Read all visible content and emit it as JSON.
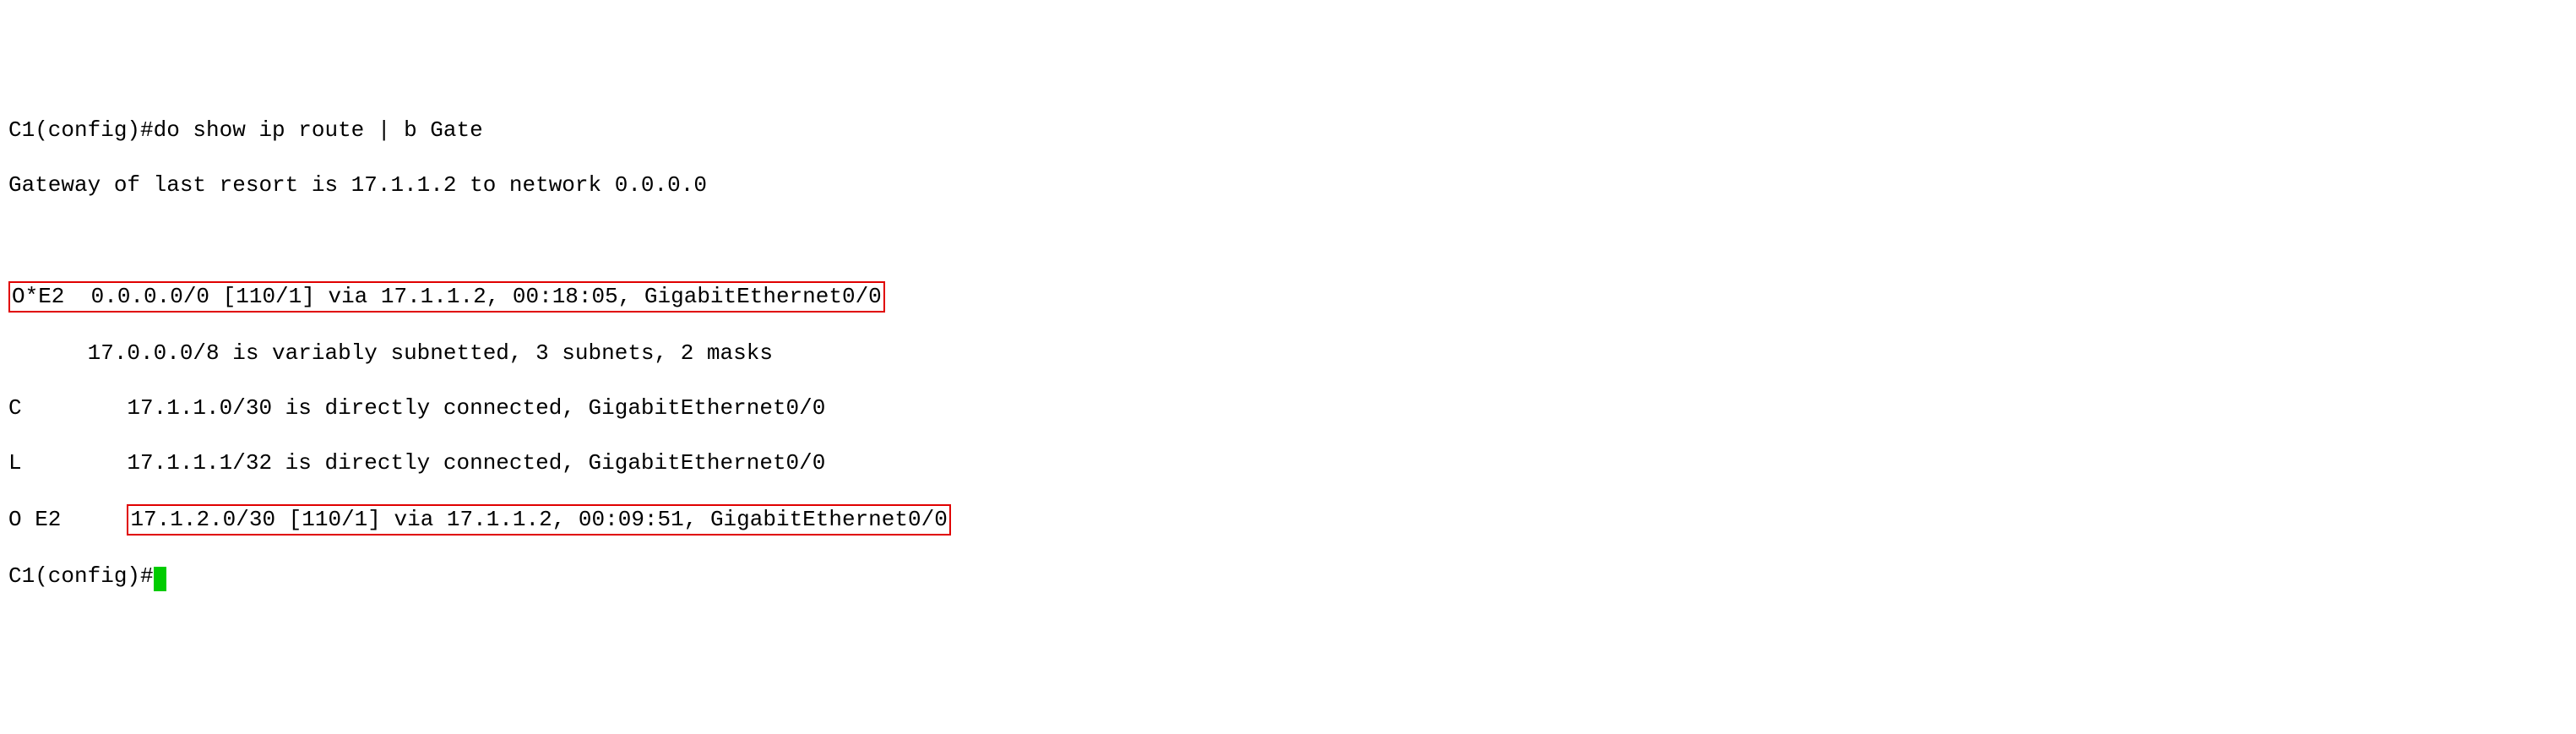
{
  "lines": {
    "cmd": "C1(config)#do show ip route | b Gate",
    "gateway": "Gateway of last resort is 17.1.1.2 to network 0.0.0.0",
    "blank1": " ",
    "default_route": "O*E2  0.0.0.0/0 [110/1] via 17.1.1.2, 00:18:05, GigabitEthernet0/0",
    "subnet_hdr": "      17.0.0.0/8 is variably subnetted, 3 subnets, 2 masks",
    "connected": "C        17.1.1.0/30 is directly connected, GigabitEthernet0/0",
    "local": "L        17.1.1.1/32 is directly connected, GigabitEthernet0/0",
    "e2_prefix": "O E2     ",
    "e2_boxed": "17.1.2.0/30 [110/1] via 17.1.1.2, 00:09:51, GigabitEthernet0/0",
    "prompt": "C1(config)#"
  }
}
